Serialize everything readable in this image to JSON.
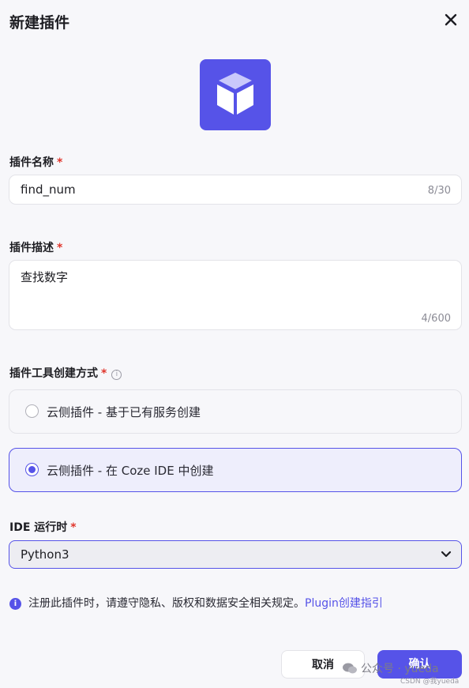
{
  "dialog": {
    "title": "新建插件"
  },
  "colors": {
    "accent": "#5653e8",
    "required": "#e0352b",
    "background": "#f7f7fa"
  },
  "icons": {
    "close": "close-icon",
    "logo": "cube-icon",
    "info": "info-icon",
    "notice": "info-filled-icon",
    "dropdown": "chevron-down-icon"
  },
  "plugin_name": {
    "label": "插件名称",
    "required": "*",
    "value": "find_num",
    "counter": "8/30"
  },
  "plugin_desc": {
    "label": "插件描述",
    "required": "*",
    "value": "查找数字",
    "counter": "4/600"
  },
  "create_method": {
    "label": "插件工具创建方式",
    "required": "*",
    "info_glyph": "i",
    "options": [
      {
        "label": "云侧插件 - 基于已有服务创建",
        "selected": false
      },
      {
        "label": "云侧插件 - 在 Coze IDE 中创建",
        "selected": true
      }
    ]
  },
  "ide_runtime": {
    "label": "IDE 运行时",
    "required": "*",
    "value": "Python3"
  },
  "notice": {
    "icon_glyph": "i",
    "text": "注册此插件时，请遵守隐私、版权和数据安全相关规定。",
    "link": "Plugin创建指引"
  },
  "actions": {
    "cancel": "取消",
    "confirm": "确认"
  },
  "watermark": {
    "line1": "公众号 · yueda",
    "line2": "CSDN @我yueda"
  }
}
